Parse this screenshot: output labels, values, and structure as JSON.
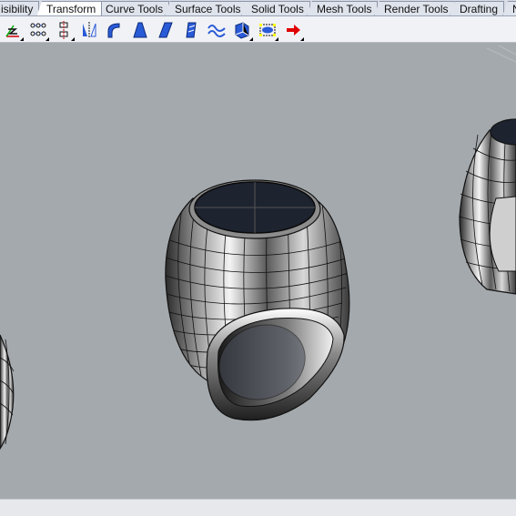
{
  "tabs": [
    {
      "label": "isibility"
    },
    {
      "label": "Transform"
    },
    {
      "label": "Curve Tools"
    },
    {
      "label": "Surface Tools"
    },
    {
      "label": "Solid Tools"
    },
    {
      "label": "Mesh Tools"
    },
    {
      "label": "Render Tools"
    },
    {
      "label": "Drafting"
    },
    {
      "label": "N"
    }
  ],
  "active_tab": "Transform",
  "toolbar": {
    "icons": [
      "set-zero-axis-icon",
      "array-along-points-icon",
      "align-icon",
      "mirror-icon",
      "bend-icon",
      "taper-icon",
      "shear-icon",
      "twist-icon",
      "smooth-icon",
      "flow-along-surface-icon",
      "cage-edit-icon",
      "arrow-right-icon"
    ]
  },
  "colors": {
    "viewport_bg": "#a4a9ad",
    "tab_active": "#ffffff",
    "toolbar_bg": "#f1f2f6",
    "ring_top": "#1e2330",
    "red_arrow": "#e00000"
  }
}
